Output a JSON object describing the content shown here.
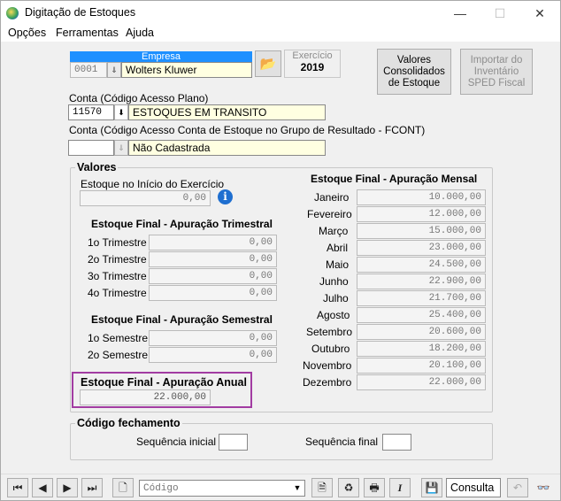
{
  "window": {
    "title": "Digitação de Estoques",
    "minimize": "—",
    "maximize": "☐",
    "close": "✕"
  },
  "menu": [
    "Opções",
    "Ferramentas",
    "Ajuda"
  ],
  "empresa": {
    "label": "Empresa",
    "code": "0001",
    "name": "Wolters Kluwer"
  },
  "exercicio": {
    "label": "Exercício",
    "value": "2019"
  },
  "buttons": {
    "valores_consolidados": [
      "Valores",
      "Consolidados",
      "de Estoque"
    ],
    "importar": [
      "Importar do",
      "Inventário",
      "SPED Fiscal"
    ]
  },
  "conta": {
    "label": "Conta (Código Acesso Plano)",
    "code": "11570",
    "name": "ESTOQUES EM TRANSITO"
  },
  "conta_fcont": {
    "label": "Conta (Código Acesso Conta de Estoque no Grupo de Resultado - FCONT)",
    "code": "",
    "name": "Não Cadastrada"
  },
  "valores": {
    "title": "Valores",
    "inicio_label": "Estoque no Início do Exercício",
    "inicio_value": "0,00",
    "trimestral": {
      "title": "Estoque Final - Apuração Trimestral",
      "rows": [
        {
          "label": "1o Trimestre",
          "value": "0,00"
        },
        {
          "label": "2o Trimestre",
          "value": "0,00"
        },
        {
          "label": "3o Trimestre",
          "value": "0,00"
        },
        {
          "label": "4o Trimestre",
          "value": "0,00"
        }
      ]
    },
    "semestral": {
      "title": "Estoque Final - Apuração Semestral",
      "rows": [
        {
          "label": "1o Semestre",
          "value": "0,00"
        },
        {
          "label": "2o Semestre",
          "value": "0,00"
        }
      ]
    },
    "anual": {
      "title": "Estoque Final - Apuração Anual",
      "value": "22.000,00"
    },
    "mensal": {
      "title": "Estoque Final - Apuração Mensal",
      "rows": [
        {
          "label": "Janeiro",
          "value": "10.000,00"
        },
        {
          "label": "Fevereiro",
          "value": "12.000,00"
        },
        {
          "label": "Março",
          "value": "15.000,00"
        },
        {
          "label": "Abril",
          "value": "23.000,00"
        },
        {
          "label": "Maio",
          "value": "24.500,00"
        },
        {
          "label": "Junho",
          "value": "22.900,00"
        },
        {
          "label": "Julho",
          "value": "21.700,00"
        },
        {
          "label": "Agosto",
          "value": "25.400,00"
        },
        {
          "label": "Setembro",
          "value": "20.600,00"
        },
        {
          "label": "Outubro",
          "value": "18.200,00"
        },
        {
          "label": "Novembro",
          "value": "20.100,00"
        },
        {
          "label": "Dezembro",
          "value": "22.000,00"
        }
      ]
    }
  },
  "fechamento": {
    "title": "Código fechamento",
    "inicial_label": "Sequência inicial",
    "inicial_value": "",
    "final_label": "Sequência final",
    "final_value": ""
  },
  "toolbar": {
    "search_placeholder": "Código",
    "status": "Consulta"
  },
  "colors": {
    "highlight": "#a23ca2",
    "empresa_header": "#1e90ff",
    "yellow_field": "#ffffe1"
  }
}
